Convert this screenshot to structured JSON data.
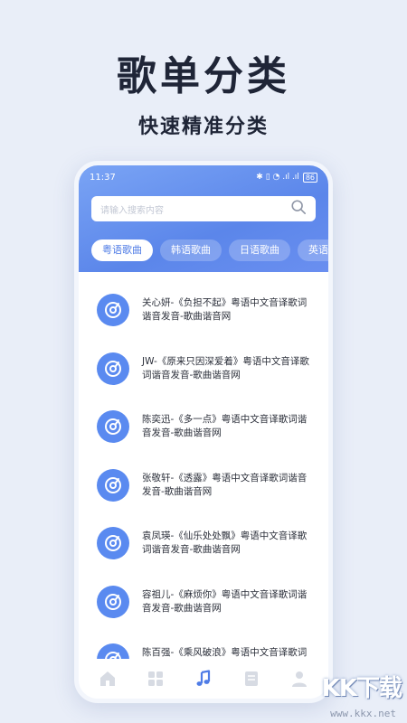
{
  "promo": {
    "title": "歌单分类",
    "subtitle": "快速精准分类"
  },
  "status": {
    "time": "11:37",
    "icons": "✱ ▯ ◔ .ıl .ıl",
    "battery": "86"
  },
  "search": {
    "placeholder": "请输入搜索内容"
  },
  "tabs": [
    "粤语歌曲",
    "韩语歌曲",
    "日语歌曲",
    "英语歌曲"
  ],
  "songs": [
    "关心妍-《负担不起》粤语中文音译歌词谐音发音-歌曲谐音网",
    "JW-《原来只因深爱着》粤语中文音译歌词谐音发音-歌曲谐音网",
    "陈奕迅-《多一点》粤语中文音译歌词谐音发音-歌曲谐音网",
    "张敬轩-《透露》粤语中文音译歌词谐音发音-歌曲谐音网",
    "袁凤瑛-《仙乐处处飘》粤语中文音译歌词谐音发音-歌曲谐音网",
    "容祖儿-《麻烦你》粤语中文音译歌词谐音发音-歌曲谐音网",
    "陈百强-《乘风破浪》粤语中文音译歌词谐音发音-歌曲谐音网"
  ],
  "nav": [
    "home-icon",
    "grid-icon",
    "music-note-icon",
    "document-icon",
    "user-icon"
  ],
  "colors": {
    "accent": "#5b86ea",
    "background": "#e9eef8",
    "text": "#1f2537"
  },
  "watermark": {
    "logo": "KK下载",
    "url": "www.kkx.net"
  }
}
